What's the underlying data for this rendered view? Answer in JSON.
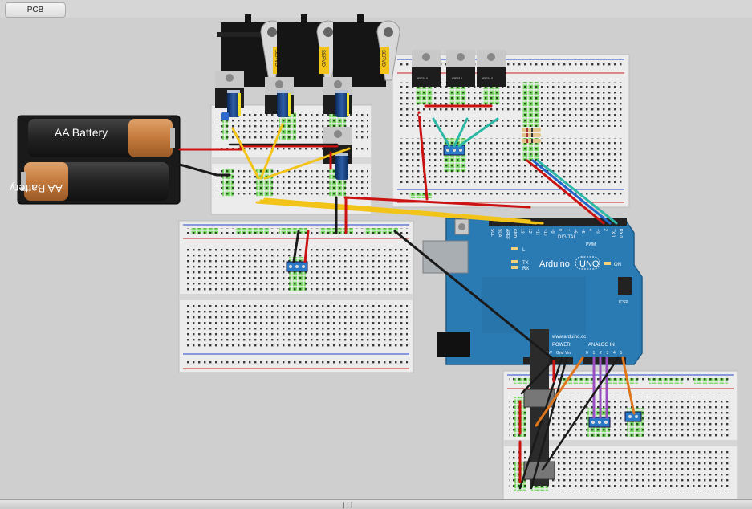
{
  "tabs": {
    "active_label": "PCB"
  },
  "battery_pack": {
    "cell1_label": "AA Battery",
    "cell2_label": "AA Battery"
  },
  "servo": {
    "label": "SERVO"
  },
  "mosfet": {
    "label": "IRF510"
  },
  "arduino": {
    "board_name": "Arduino",
    "model": "UNO",
    "website": "www.arduino.cc",
    "header_digital": "DIGITAL",
    "header_power": "POWER",
    "header_analog": "ANALOG IN",
    "icsp": "ICSP",
    "led_on": "ON",
    "led_l": "L",
    "led_tx": "TX",
    "led_rx": "RX",
    "pwm": "PWM",
    "digital_pins": [
      "SCL",
      "SDA",
      "AREF",
      "GND",
      "13",
      "12",
      "~11",
      "~10",
      "~9",
      "8",
      "7",
      "~6",
      "~5",
      "4",
      "~3",
      "2",
      "TX 1",
      "RX 0"
    ],
    "power_pins": [
      "5V",
      "Gnd",
      "Vin"
    ],
    "analog_pins": [
      "0",
      "1",
      "2",
      "3",
      "4",
      "5"
    ]
  },
  "status": {
    "grip": "|||"
  },
  "colors": {
    "canvas": "#cfcfcf",
    "arduino_blue": "#2a7bb4",
    "wire_red": "#cc1111",
    "wire_yellow": "#f2c318",
    "wire_teal": "#2cb8a4",
    "wire_blue": "#2266cc",
    "wire_orange": "#e0761c",
    "wire_purple": "#9a4fc0",
    "wire_black": "#1a1a1a"
  }
}
